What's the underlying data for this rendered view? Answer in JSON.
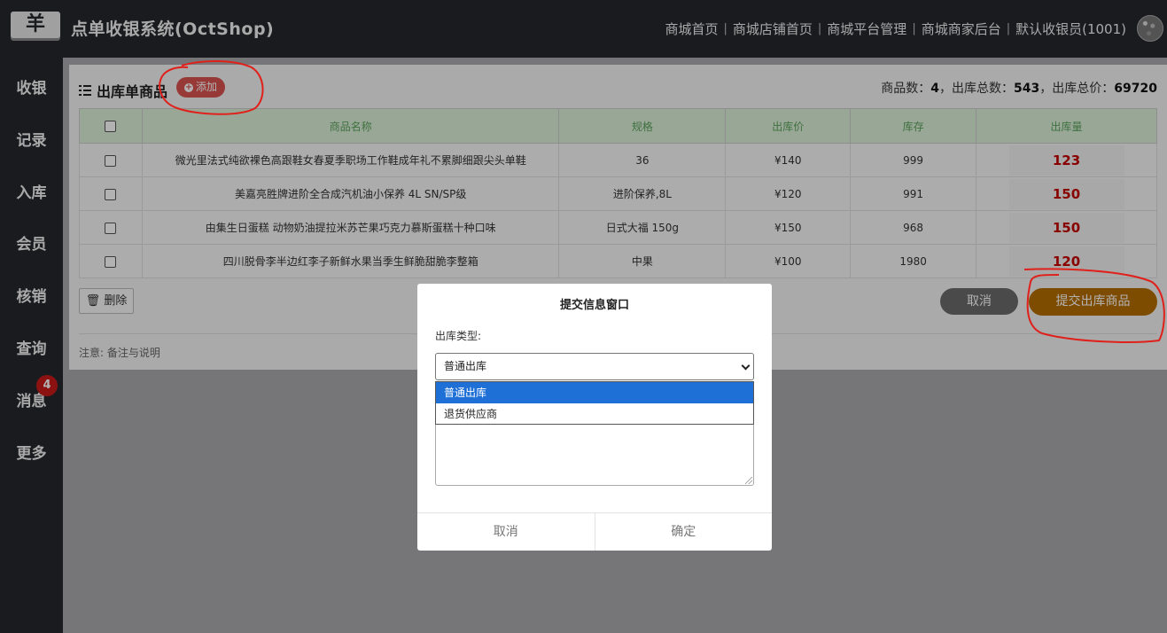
{
  "header": {
    "logo_glyph": "羊",
    "title": "点单收银系统(OctShop)",
    "links": [
      "商城首页",
      "商城店铺首页",
      "商城平台管理",
      "商城商家后台",
      "默认收银员(1001)"
    ]
  },
  "sidebar": {
    "items": [
      {
        "label": "收银"
      },
      {
        "label": "记录"
      },
      {
        "label": "入库"
      },
      {
        "label": "会员"
      },
      {
        "label": "核销"
      },
      {
        "label": "查询"
      },
      {
        "label": "消息",
        "badge": "4"
      },
      {
        "label": "更多"
      }
    ]
  },
  "panel": {
    "title": "出库单商品",
    "add_label": "添加",
    "summary": {
      "count_label": "商品数：",
      "count": "4",
      "total_label": "，出库总数：",
      "total": "543",
      "price_label": "，出库总价：",
      "price": "69720"
    },
    "columns": [
      "商品名称",
      "规格",
      "出库价",
      "库存",
      "出库量"
    ],
    "rows": [
      {
        "name": "微光里法式纯欲裸色高跟鞋女春夏季职场工作鞋成年礼不累脚细跟尖头单鞋",
        "spec": "36",
        "price": "¥140",
        "stock": "999",
        "qty": "123"
      },
      {
        "name": "美嘉亮胜牌进阶全合成汽机油小保养 4L SN/SP级",
        "spec": "进阶保养,8L",
        "price": "¥120",
        "stock": "991",
        "qty": "150"
      },
      {
        "name": "由集生日蛋糕 动物奶油提拉米苏芒果巧克力慕斯蛋糕十种口味",
        "spec": "日式大福 150g",
        "price": "¥150",
        "stock": "968",
        "qty": "150"
      },
      {
        "name": "四川脱骨李半边红李子新鲜水果当季生鲜脆甜脆李整箱",
        "spec": "中果",
        "price": "¥100",
        "stock": "1980",
        "qty": "120"
      }
    ],
    "delete_label": "删除",
    "cancel_label": "取消",
    "submit_label": "提交出库商品",
    "note": "注意: 备注与说明"
  },
  "modal": {
    "title": "提交信息窗口",
    "type_label": "出库类型:",
    "selected": "普通出库",
    "options": [
      "普通出库",
      "退货供应商"
    ],
    "cancel_label": "取消",
    "confirm_label": "确定"
  },
  "colors": {
    "header_bg": "#26282c",
    "accent_red": "#d9534f",
    "qty_red": "#c40000",
    "submit_brown": "#b56e00",
    "th_green_text": "#5ba35b",
    "th_green_bg": "#dcefd9",
    "dropdown_highlight": "#1e6fd6",
    "annotation_red": "#e0201a"
  }
}
